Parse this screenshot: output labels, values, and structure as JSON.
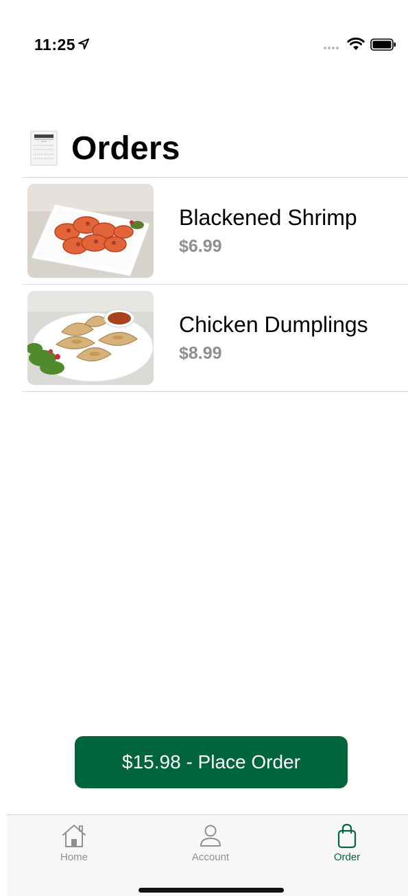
{
  "status_bar": {
    "time": "11:25",
    "icons": [
      "location-arrow-icon",
      "signal-dots-icon",
      "wifi-icon",
      "battery-icon"
    ]
  },
  "header": {
    "icon": "receipt-icon",
    "title": "Orders"
  },
  "orders": [
    {
      "name": "Blackened Shrimp",
      "price": "$6.99",
      "image": "shrimp-plate-image"
    },
    {
      "name": "Chicken Dumplings",
      "price": "$8.99",
      "image": "dumplings-plate-image"
    }
  ],
  "place_order": {
    "label": "$15.98 - Place Order"
  },
  "tab_bar": {
    "tabs": [
      {
        "label": "Home",
        "icon": "home-icon",
        "active": false
      },
      {
        "label": "Account",
        "icon": "person-icon",
        "active": false
      },
      {
        "label": "Order",
        "icon": "bag-icon",
        "active": true
      }
    ]
  },
  "colors": {
    "accent": "#00643c",
    "secondary_text": "#8e8e93",
    "separator": "#dcdcdc"
  }
}
